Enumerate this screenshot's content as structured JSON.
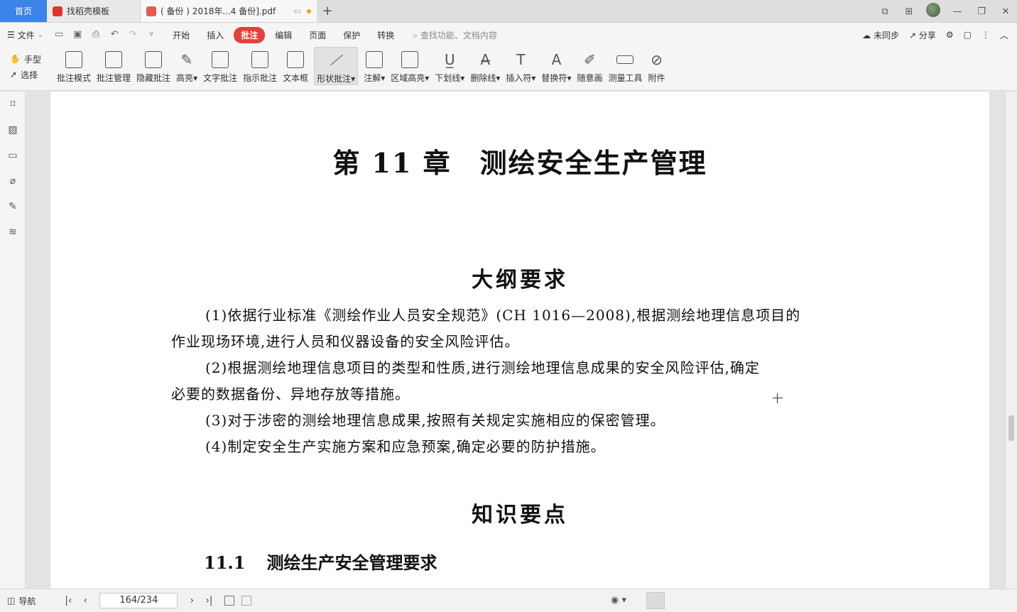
{
  "tabs": {
    "home": "首页",
    "template": "找稻壳模板",
    "document": "( 备份 ) 2018年...4 备份].pdf"
  },
  "menubar": {
    "file": "文件",
    "tabs": [
      "开始",
      "插入",
      "批注",
      "编辑",
      "页面",
      "保护",
      "转换"
    ],
    "active_tab": "批注",
    "search_placeholder": "查找功能、文档内容",
    "sync": "未同步",
    "share": "分享"
  },
  "ribbon": {
    "hand": "手型",
    "select": "选择",
    "tools": [
      {
        "label": "批注模式",
        "icon": "annotation-mode-icon"
      },
      {
        "label": "批注管理",
        "icon": "annotation-manage-icon"
      },
      {
        "label": "隐藏批注",
        "icon": "hide-annotation-icon"
      },
      {
        "label": "高亮",
        "icon": "highlight-icon"
      },
      {
        "label": "文字批注",
        "icon": "text-annotation-icon"
      },
      {
        "label": "指示批注",
        "icon": "pointer-annotation-icon"
      },
      {
        "label": "文本框",
        "icon": "textbox-icon"
      },
      {
        "label": "形状批注",
        "icon": "shape-annotation-icon"
      },
      {
        "label": "注解",
        "icon": "note-icon"
      },
      {
        "label": "区域高亮",
        "icon": "area-highlight-icon"
      },
      {
        "label": "下划线",
        "icon": "underline-icon"
      },
      {
        "label": "删除线",
        "icon": "strikethrough-icon"
      },
      {
        "label": "插入符",
        "icon": "insert-caret-icon"
      },
      {
        "label": "替换符",
        "icon": "replace-icon"
      },
      {
        "label": "随意画",
        "icon": "freehand-icon"
      },
      {
        "label": "测量工具",
        "icon": "ruler-icon"
      },
      {
        "label": "附件",
        "icon": "attachment-icon"
      }
    ],
    "dropdown_arrow": "▾"
  },
  "document": {
    "chapter": "第 11 章　测绘安全生产管理",
    "outline_title": "大纲要求",
    "p1_line1": "(1)依据行业标准《测绘作业人员安全规范》(CH 1016—2008),根据测绘地理信息项目的",
    "p1_line2": "作业现场环境,进行人员和仪器设备的安全风险评估。",
    "p2_line1": "(2)根据测绘地理信息项目的类型和性质,进行测绘地理信息成果的安全风险评估,确定",
    "p2_line2": "必要的数据备份、异地存放等措施。",
    "p3": "(3)对于涉密的测绘地理信息成果,按照有关规定实施相应的保密管理。",
    "p4": "(4)制定安全生产实施方案和应急预案,确定必要的防护措施。",
    "knowledge_title": "知识要点",
    "section_num": "11.1",
    "section_title": "测绘生产安全管理要求"
  },
  "statusbar": {
    "nav": "导航",
    "page_indicator": "164/234"
  },
  "colors": {
    "home_tab": "#3b83e6",
    "active_menu": "#e4403c",
    "unsaved_dot": "#f0a020"
  }
}
